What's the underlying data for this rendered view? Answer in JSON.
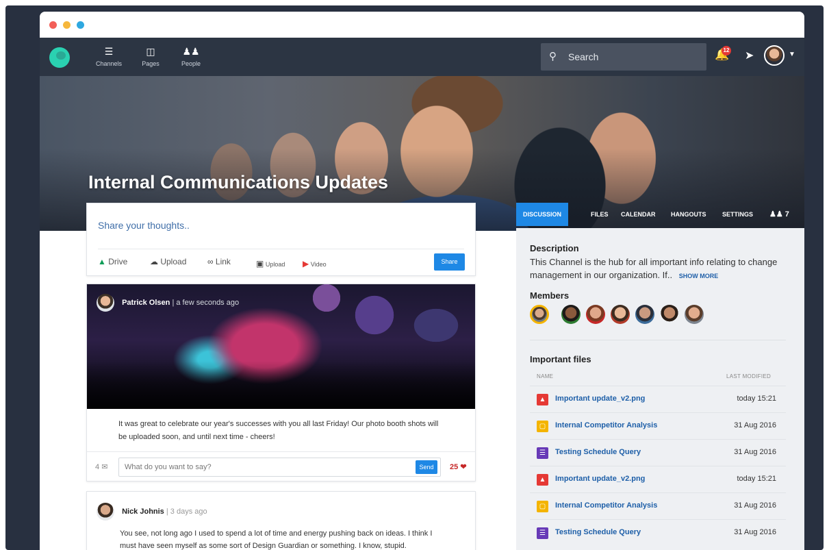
{
  "nav": {
    "items": [
      {
        "label": "Channels",
        "icon": "layers-icon"
      },
      {
        "label": "Pages",
        "icon": "book-icon"
      },
      {
        "label": "People",
        "icon": "people-icon"
      }
    ],
    "search_placeholder": "Search",
    "notification_count": "12"
  },
  "channel": {
    "title": "Internal Communications Updates",
    "tabs": [
      "DISCUSSION",
      "FILES",
      "CALENDAR",
      "HANGOUTS",
      "SETTINGS"
    ],
    "active_tab": "DISCUSSION",
    "member_count": "7"
  },
  "composer": {
    "placeholder": "Share your thoughts..",
    "tools": [
      "Drive",
      "Upload",
      "Link",
      "Upload",
      "Video"
    ],
    "share_label": "Share"
  },
  "posts": [
    {
      "author": "Patrick Olsen",
      "time": "| a few seconds ago",
      "text": "It was great to celebrate our year's successes with you all last Friday! Our photo booth shots will be uploaded soon, and until next time - cheers!",
      "comments": "4",
      "reply_placeholder": "What do you want to say?",
      "send_label": "Send",
      "likes": "25"
    },
    {
      "author": "Nick Johnis",
      "time": "| 3 days ago",
      "text": "You see, not long ago I used to spend a lot of time and energy pushing back on ideas. I think I must have seen myself as some sort of Design Guardian or something. I know, stupid."
    }
  ],
  "sidebar": {
    "description_label": "Description",
    "description": "This Channel is the hub for all important info relating to change management in our organization. If..",
    "show_more": "SHOW MORE",
    "members_label": "Members",
    "files_label": "Important files",
    "col_name": "NAME",
    "col_modified": "LAST MODIFIED",
    "files": [
      {
        "name": "Important update_v2.png",
        "date": "today 15:21",
        "type": "image",
        "color": "#e53935"
      },
      {
        "name": "Internal Competitor Analysis",
        "date": "31 Aug 2016",
        "type": "slides",
        "color": "#f4b400"
      },
      {
        "name": "Testing Schedule Query",
        "date": "31 Aug 2016",
        "type": "form",
        "color": "#673ab7"
      },
      {
        "name": "Important update_v2.png",
        "date": "today 15:21",
        "type": "image",
        "color": "#e53935"
      },
      {
        "name": "Internal Competitor Analysis",
        "date": "31 Aug 2016",
        "type": "slides",
        "color": "#f4b400"
      },
      {
        "name": "Testing Schedule Query",
        "date": "31 Aug 2016",
        "type": "form",
        "color": "#673ab7"
      }
    ]
  },
  "colors": {
    "accent": "#1e88e5",
    "nav_bg": "#2c3543",
    "brand": "#2ad1b1",
    "like": "#c62828"
  }
}
